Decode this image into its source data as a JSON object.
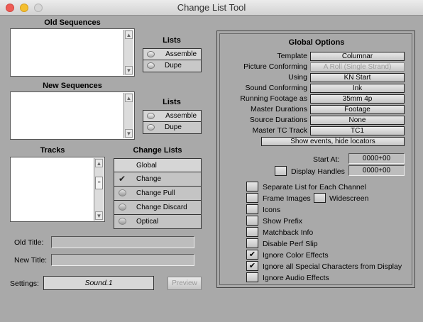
{
  "window": {
    "title": "Change List Tool"
  },
  "old_sequences": {
    "label": "Old Sequences"
  },
  "new_sequences": {
    "label": "New Sequences"
  },
  "lists1": {
    "label": "Lists",
    "options": [
      "Assemble",
      "Dupe"
    ]
  },
  "lists2": {
    "label": "Lists",
    "options": [
      "Assemble",
      "Dupe"
    ]
  },
  "tracks": {
    "label": "Tracks"
  },
  "change_lists": {
    "label": "Change Lists",
    "items": [
      {
        "label": "Global",
        "state": "none"
      },
      {
        "label": "Change",
        "state": "checked"
      },
      {
        "label": "Change Pull",
        "state": "radio"
      },
      {
        "label": "Change Discard",
        "state": "radio"
      },
      {
        "label": "Optical",
        "state": "radio"
      }
    ]
  },
  "old_title": {
    "label": "Old Title:",
    "value": ""
  },
  "new_title": {
    "label": "New Title:",
    "value": ""
  },
  "settings": {
    "label": "Settings:",
    "value": "Sound.1",
    "preview_label": "Preview"
  },
  "global_options": {
    "title": "Global Options",
    "rows": [
      {
        "label": "Template",
        "value": "Columnar",
        "enabled": true
      },
      {
        "label": "Picture Conforming",
        "value": "A Roll (Single Strand)",
        "enabled": false
      },
      {
        "label": "Using",
        "value": "KN Start",
        "enabled": true
      },
      {
        "label": "Sound Conforming",
        "value": "Ink",
        "enabled": true
      },
      {
        "label": "Running Footage as",
        "value": "35mm 4p",
        "enabled": true
      },
      {
        "label": "Master Durations",
        "value": "Footage",
        "enabled": true
      },
      {
        "label": "Source Durations",
        "value": "None",
        "enabled": true
      },
      {
        "label": "Master TC Track",
        "value": "TC1",
        "enabled": true
      }
    ],
    "show_events_label": "Show events, hide locators",
    "start_at_label": "Start At:",
    "start_at_value": "0000+00",
    "display_handles_label": "Display Handles",
    "display_handles_value": "0000+00",
    "checkboxes": [
      {
        "label": "Separate List for Each Channel",
        "checked": false
      },
      {
        "label": "Frame Images",
        "checked": false
      },
      {
        "label": "Icons",
        "checked": false
      },
      {
        "label": "Show Prefix",
        "checked": false
      },
      {
        "label": "Matchback Info",
        "checked": false
      },
      {
        "label": "Disable Perf Slip",
        "checked": false
      },
      {
        "label": "Ignore Color Effects",
        "checked": true
      },
      {
        "label": "Ignore all Special Characters from Display",
        "checked": true
      },
      {
        "label": "Ignore Audio Effects",
        "checked": false
      }
    ],
    "widescreen_label": "Widescreen",
    "check_mark": "✔"
  }
}
